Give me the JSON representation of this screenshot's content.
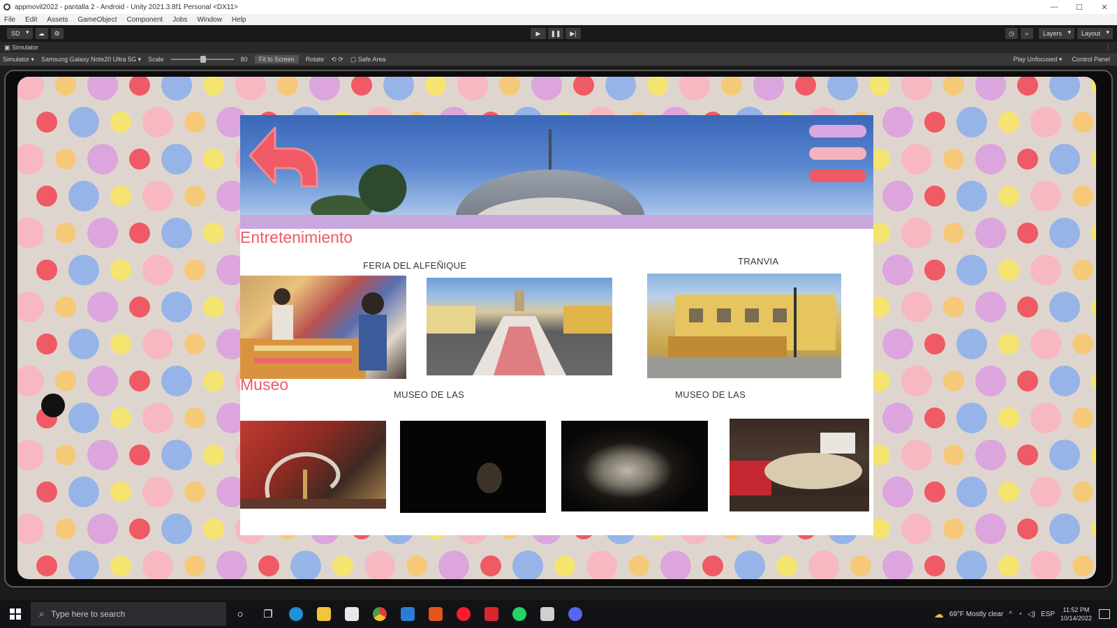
{
  "window": {
    "title": "appmovil2022 - pantalla 2 - Android - Unity 2021.3.8f1 Personal <DX11>",
    "controls": [
      "—",
      "☐",
      "✕"
    ]
  },
  "menu": [
    "File",
    "Edit",
    "Assets",
    "GameObject",
    "Component",
    "Jobs",
    "Window",
    "Help"
  ],
  "toolbar": {
    "account_label": "SD",
    "layers_label": "Layers",
    "layout_label": "Layout"
  },
  "panel": {
    "tab_label": "Simulator"
  },
  "simulator": {
    "mode_label": "Simulator",
    "device_label": "Samsung Galaxy Note20 Ultra 5G",
    "scale_label": "Scale",
    "scale_value": "80",
    "fit_label": "Fit to Screen",
    "rotate_label": "Rotate",
    "safe_area_label": "Safe Area",
    "play_mode_label": "Play Unfocused",
    "control_panel_label": "Control Panel"
  },
  "app": {
    "section_entertainment": "Entretenimiento",
    "section_museum": "Museo",
    "caption_feria": "FERIA DEL ALFEÑIQUE",
    "caption_tranvia": "TRANVIA",
    "caption_museo_1": "MUSEO DE LAS",
    "caption_museo_2": "MUSEO DE LAS"
  },
  "colors": {
    "accent_red": "#ef5a64",
    "menu_lilac": "#d9a8e0",
    "menu_pink": "#f4b3c0",
    "menu_red": "#ef5a64",
    "banner_band": "#c9a8de"
  },
  "taskbar": {
    "search_placeholder": "Type here to search",
    "weather": "69°F  Mostly clear",
    "language": "ESP",
    "time": "11:52 PM",
    "date": "10/14/2022"
  }
}
